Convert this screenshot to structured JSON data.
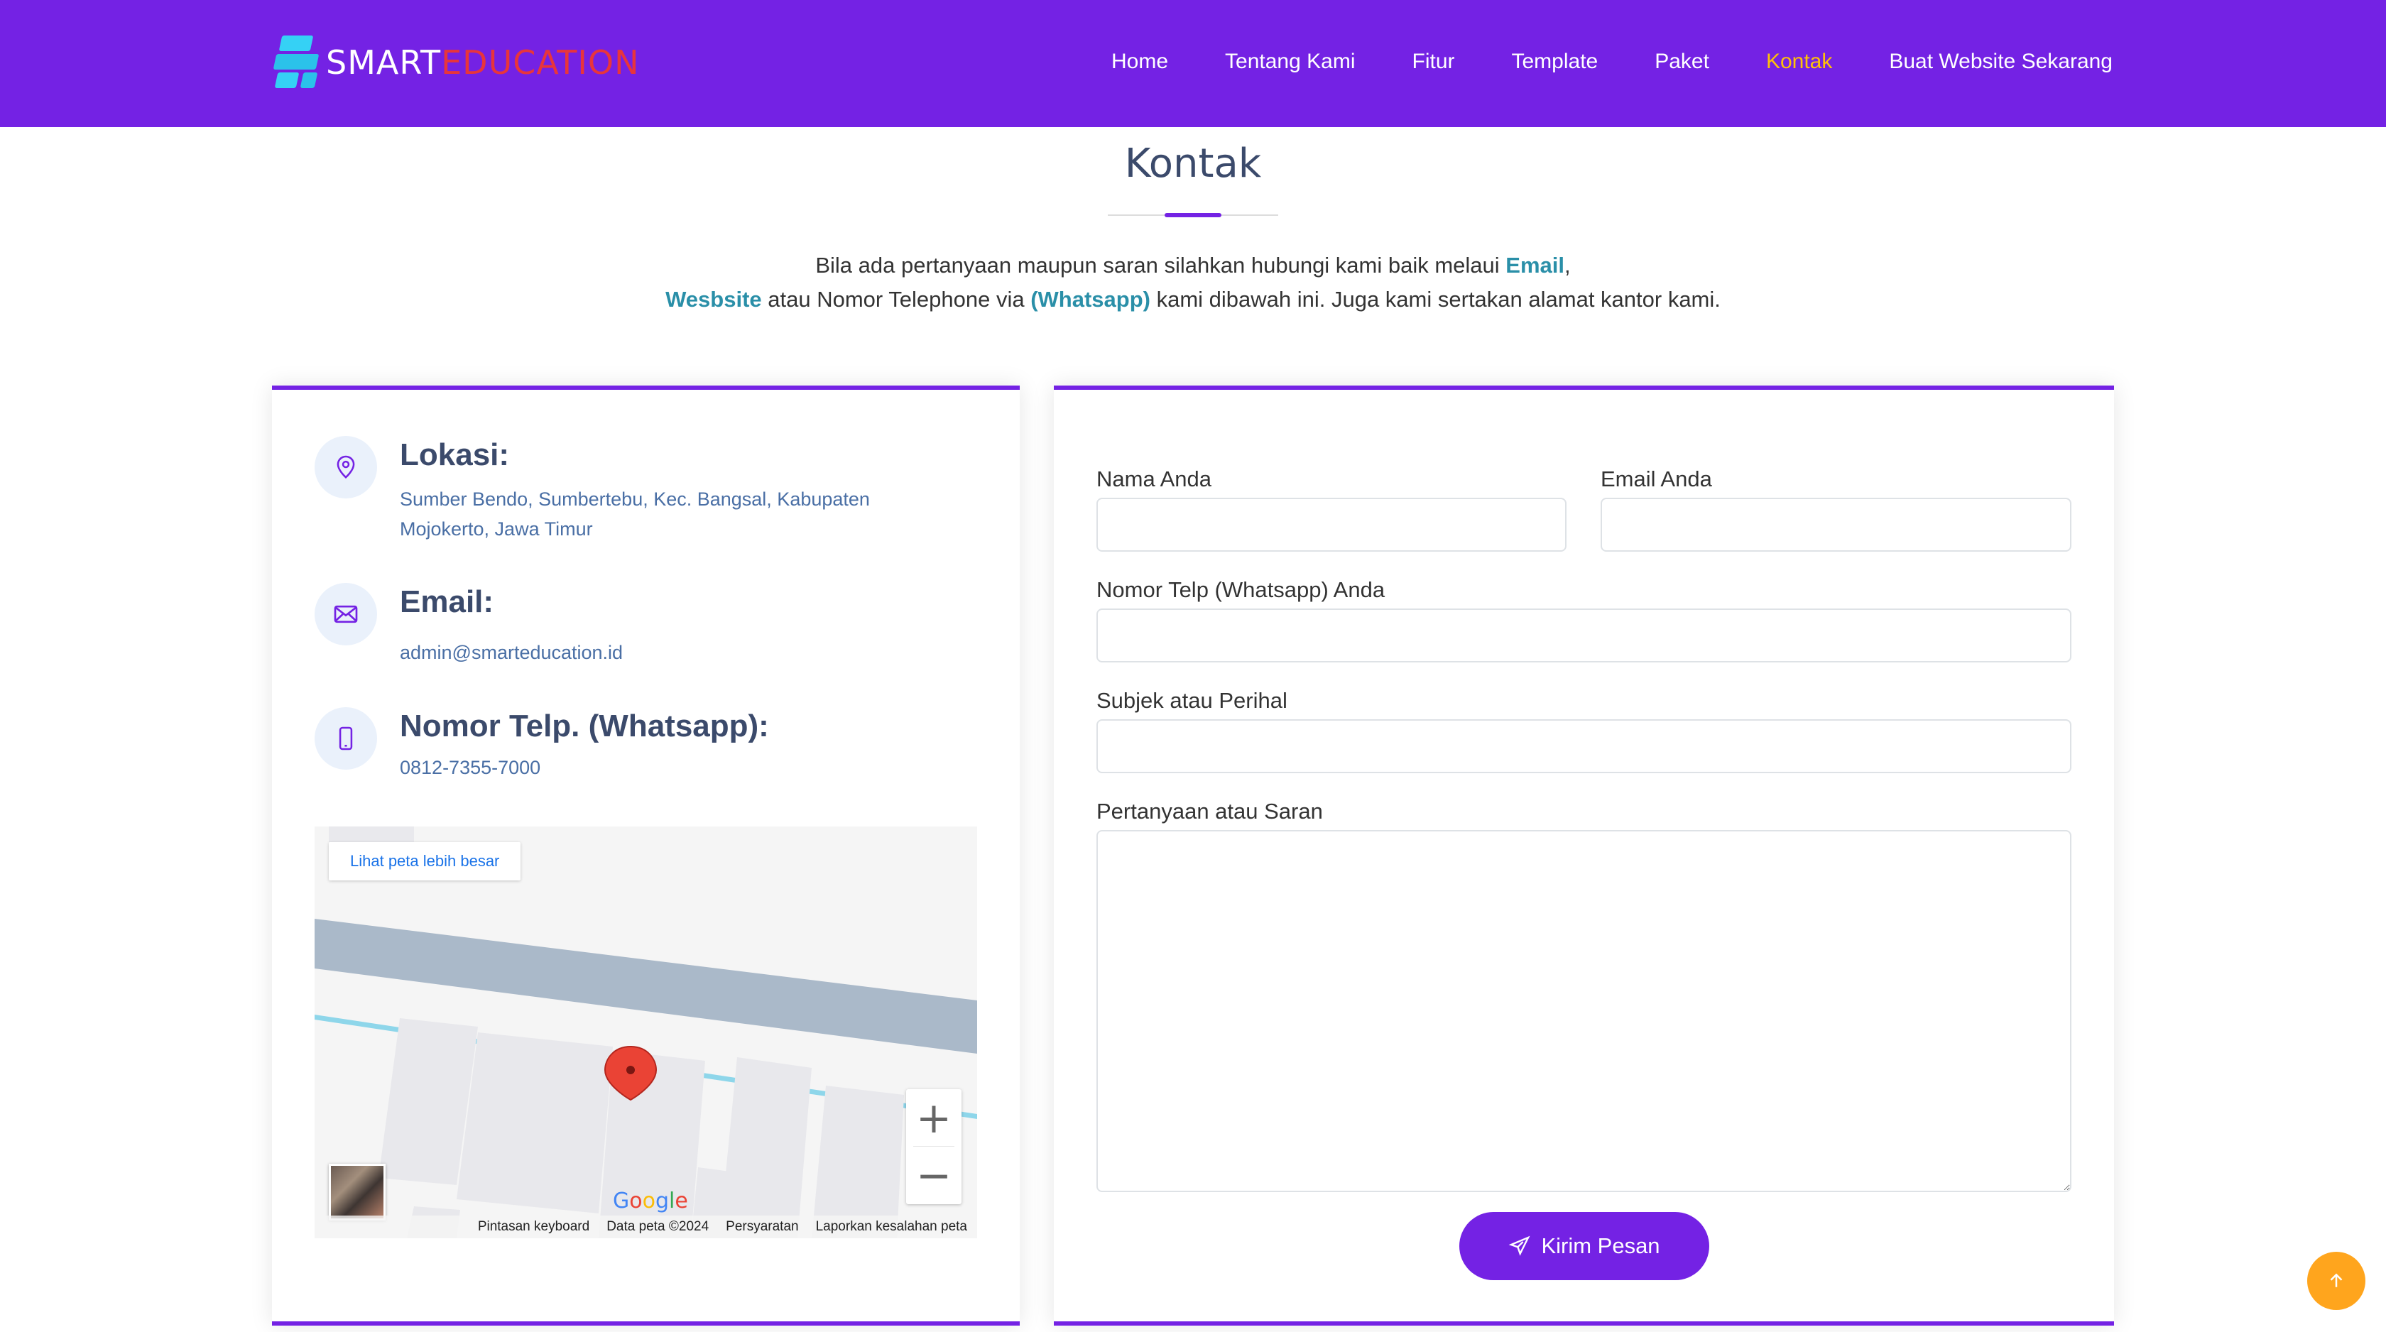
{
  "header": {
    "logo_part1": "SMART",
    "logo_part2": "EDUCATION",
    "nav": [
      {
        "label": "Home"
      },
      {
        "label": "Tentang Kami"
      },
      {
        "label": "Fitur"
      },
      {
        "label": "Template"
      },
      {
        "label": "Paket"
      },
      {
        "label": "Kontak",
        "active": true
      },
      {
        "label": "Buat Website Sekarang"
      }
    ]
  },
  "section": {
    "title": "Kontak",
    "intro_part1": "Bila ada pertanyaan maupun saran silahkan hubungi kami baik melaui ",
    "intro_email": "Email",
    "intro_comma": ",",
    "intro_website": "Wesbsite",
    "intro_part2": " atau Nomor Telephone via ",
    "intro_whatsapp": "(Whatsapp)",
    "intro_part3": " kami dibawah ini. Juga kami sertakan alamat kantor kami."
  },
  "contact_info": {
    "location_title": "Lokasi:",
    "location_text": "Sumber Bendo, Sumbertebu, Kec. Bangsal, Kabupaten Mojokerto, Jawa Timur",
    "email_title": "Email:",
    "email_text": "admin@smarteducation.id",
    "phone_title": "Nomor Telp. (Whatsapp):",
    "phone_text": "0812-7355-7000"
  },
  "map": {
    "view_larger": "Lihat peta lebih besar",
    "google": "Google",
    "footer": [
      "Pintasan keyboard",
      "Data peta ©2024",
      "Persyaratan",
      "Laporkan kesalahan peta"
    ],
    "zoom_in": "+",
    "zoom_out": "−"
  },
  "form": {
    "name_label": "Nama Anda",
    "email_label": "Email Anda",
    "phone_label": "Nomor Telp (Whatsapp) Anda",
    "subject_label": "Subjek atau Perihal",
    "message_label": "Pertanyaan atau Saran",
    "name_value": "",
    "email_value": "",
    "phone_value": "",
    "subject_value": "",
    "message_value": "",
    "submit_label": "Kirim Pesan"
  },
  "colors": {
    "brand": "#7422e4",
    "active_nav": "#ffc107",
    "link": "#2a8fa8",
    "back_to_top": "#ffa51d"
  }
}
